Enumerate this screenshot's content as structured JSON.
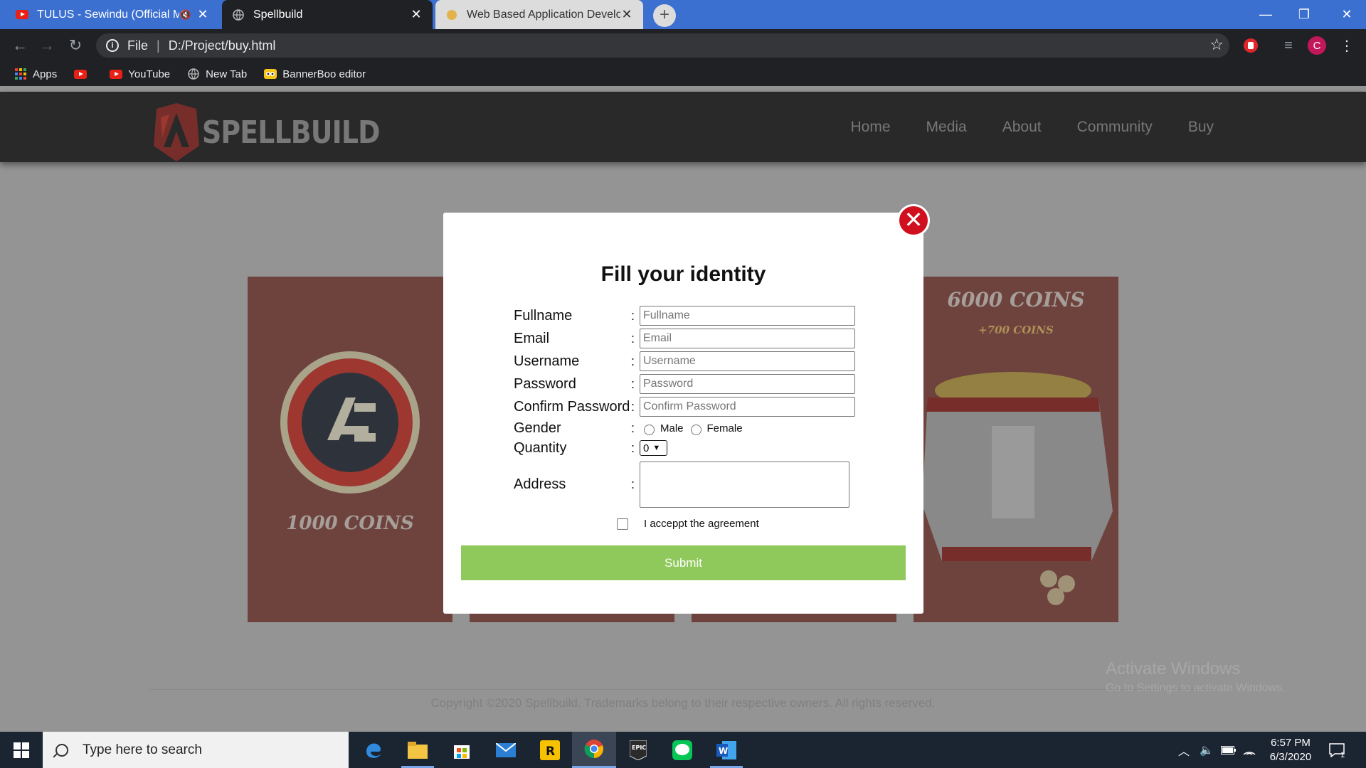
{
  "browser": {
    "tabs": [
      {
        "title": "TULUS - Sewindu (Official Music Video)"
      },
      {
        "title": "Spellbuild"
      },
      {
        "title": "Web Based Application Development"
      }
    ],
    "address": {
      "scheme": "File",
      "path": "D:/Project/buy.html"
    },
    "bookmarks": [
      "Apps",
      "YouTube",
      "New Tab",
      "BannerBoo editor"
    ],
    "profile_initial": "C"
  },
  "site": {
    "brand": "SPELLBUILD",
    "nav": [
      "Home",
      "Media",
      "About",
      "Community",
      "Buy"
    ],
    "cards": [
      {
        "label": "1000 COINS"
      },
      {
        "label": "6000 COINS",
        "bonus": "+700 COINS"
      }
    ],
    "footer": "Copyright ©2020 Spellbuild. Trademarks belong to their respective owners. All rights reserved."
  },
  "modal": {
    "title": "Fill your identity",
    "fields": {
      "fullname": {
        "label": "Fullname",
        "placeholder": "Fullname"
      },
      "email": {
        "label": "Email",
        "placeholder": "Email"
      },
      "username": {
        "label": "Username",
        "placeholder": "Username"
      },
      "password": {
        "label": "Password",
        "placeholder": "Password"
      },
      "confirm": {
        "label": "Confirm Password",
        "placeholder": "Confirm Password"
      },
      "gender": {
        "label": "Gender",
        "options": [
          "Male",
          "Female"
        ]
      },
      "quantity": {
        "label": "Quantity",
        "value": "0"
      },
      "address": {
        "label": "Address"
      }
    },
    "colon": ":",
    "agreement": "I acceppt the agreement",
    "submit": "Submit",
    "close": "✕"
  },
  "watermark": {
    "line1": "Activate Windows",
    "line2": "Go to Settings to activate Windows."
  },
  "taskbar": {
    "search_placeholder": "Type here to search",
    "time": "6:57 PM",
    "date": "6/3/2020",
    "notification_count": "1"
  },
  "colors": {
    "accent": "#8fc95b",
    "close": "#d0101e",
    "card": "#7f3d33"
  }
}
